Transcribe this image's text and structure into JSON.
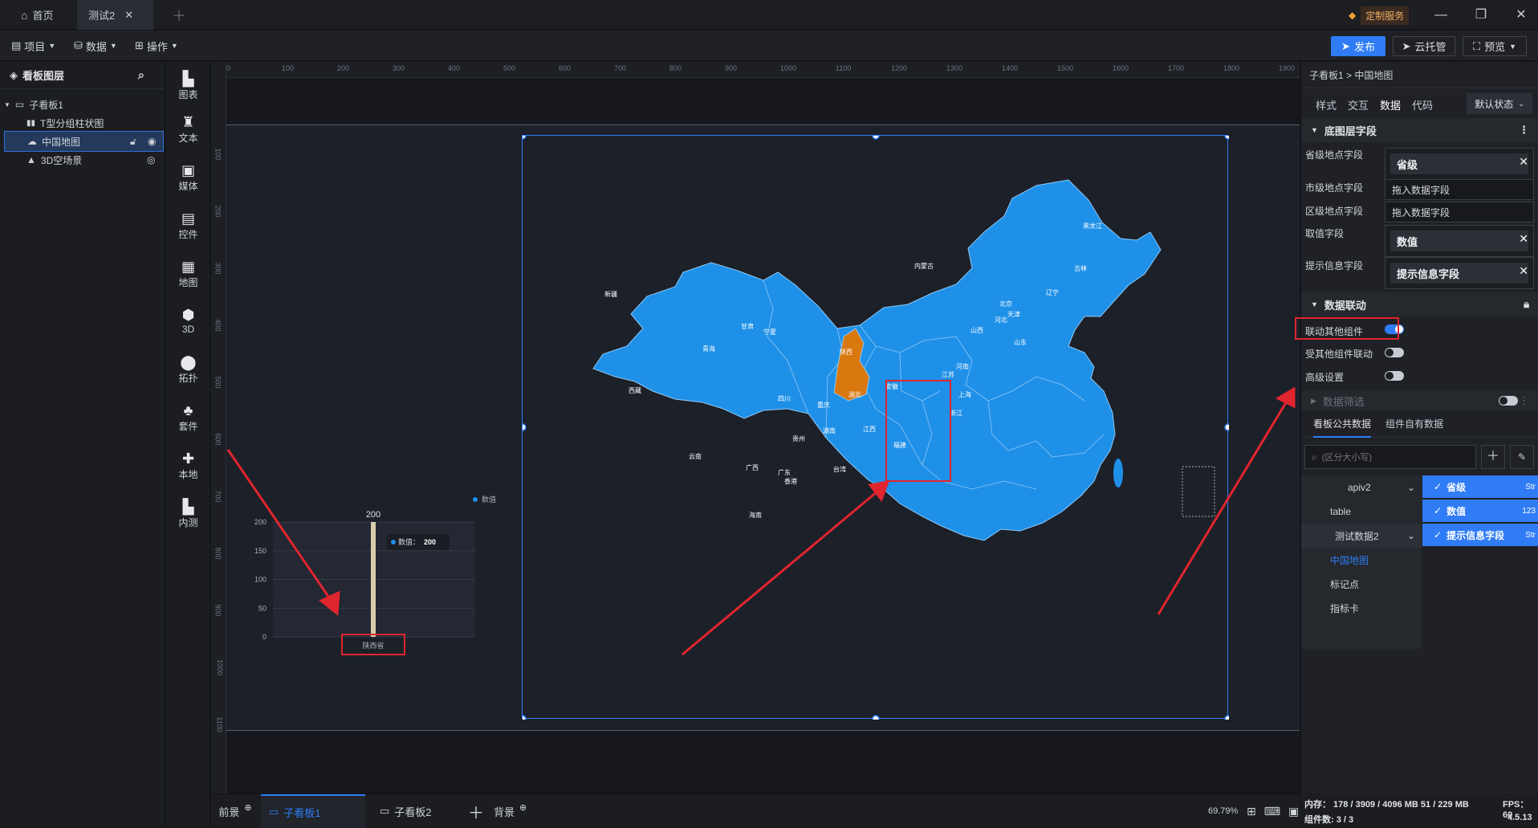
{
  "titlebar": {
    "home_tab": "首页",
    "doc_tab": "测试2",
    "custom_service": "定制服务"
  },
  "toolbar": {
    "project": "项目",
    "data": "数据",
    "operation": "操作",
    "publish": "发布",
    "cloud_host": "云托管",
    "preview": "预览"
  },
  "layers": {
    "title": "看板图层",
    "items": [
      {
        "label": "子看板1"
      },
      {
        "label": "T型分组柱状图"
      },
      {
        "label": "中国地图"
      },
      {
        "label": "3D空场景"
      }
    ]
  },
  "iconbar": [
    "图表",
    "文本",
    "媒体",
    "控件",
    "地图",
    "3D",
    "拓扑",
    "套件",
    "本地",
    "内测"
  ],
  "ruler": {
    "h_ticks": [
      "0",
      "100",
      "200",
      "300",
      "400",
      "500",
      "600",
      "700",
      "800",
      "900",
      "1000",
      "1100",
      "1200",
      "1300",
      "1400",
      "1500",
      "1600",
      "1700",
      "1800",
      "1900"
    ],
    "v_ticks": [
      "100",
      "200",
      "300",
      "400",
      "500",
      "600",
      "700",
      "800",
      "900",
      "1000",
      "1100"
    ]
  },
  "bar_chart": {
    "legend": "数值",
    "top_label": "200",
    "tooltip_label": "数值：",
    "tooltip_value": "200",
    "yticks": [
      "200",
      "150",
      "100",
      "50",
      "0"
    ],
    "category": "陕西省"
  },
  "chart_data": {
    "type": "bar",
    "categories": [
      "陕西省"
    ],
    "series": [
      {
        "name": "数值",
        "values": [
          200
        ]
      }
    ],
    "ylim": [
      0,
      200
    ]
  },
  "map": {
    "provinces": [
      "新疆",
      "西藏",
      "青海",
      "甘肃",
      "内蒙古",
      "黑龙江",
      "吉林",
      "辽宁",
      "北京",
      "天津",
      "河北",
      "山西",
      "山东",
      "宁夏",
      "陕西",
      "河南",
      "四川",
      "重庆",
      "湖北",
      "安徽",
      "江苏",
      "上海",
      "浙江",
      "贵州",
      "湖南",
      "江西",
      "福建",
      "云南",
      "广西",
      "广东",
      "台湾",
      "海南",
      "香港"
    ],
    "highlight": "陕西",
    "highlight_color": "#d9780f",
    "base_color": "#1e90e8"
  },
  "bottom": {
    "front": "前景",
    "tab1": "子看板1",
    "tab2": "子看板2",
    "background": "背景",
    "zoom": "69.79%"
  },
  "rpanel": {
    "breadcrumb": "子看板1 > 中国地图",
    "tabs": [
      "样式",
      "交互",
      "数据",
      "代码"
    ],
    "state_select": "默认状态",
    "section_base": "底图层字段",
    "fields": [
      {
        "label": "省级地点字段",
        "value": "省级",
        "type": "chip"
      },
      {
        "label": "市级地点字段",
        "value": "拖入数据字段",
        "type": "field"
      },
      {
        "label": "区级地点字段",
        "value": "拖入数据字段",
        "type": "field"
      },
      {
        "label": "取值字段",
        "value": "数值",
        "type": "chip"
      },
      {
        "label": "提示信息字段",
        "value": "提示信息字段",
        "type": "chip"
      }
    ],
    "section_link": "数据联动",
    "link_other": "联动其他组件",
    "linked_by_other": "受其他组件联动",
    "advanced": "高级设置",
    "section_filter": "数据筛选",
    "data_tabs": [
      "看板公共数据",
      "组件自有数据"
    ],
    "search_placeholder": "(区分大小写)",
    "sources": [
      {
        "label": "apiv2"
      },
      {
        "label": "table"
      },
      {
        "label": "测试数据2"
      },
      {
        "label": "中国地图"
      },
      {
        "label": "标记点"
      },
      {
        "label": "指标卡"
      }
    ],
    "source_fields": [
      {
        "label": "省级",
        "type": "Str"
      },
      {
        "label": "数值",
        "type": "123"
      },
      {
        "label": "提示信息字段",
        "type": "Str"
      }
    ]
  },
  "status": {
    "memory": "内存： 178 / 3909 / 4096 MB  51 / 229 MB",
    "fps": "FPS： 60",
    "components": "组件数: 3 / 3",
    "version": "4.5.13"
  }
}
